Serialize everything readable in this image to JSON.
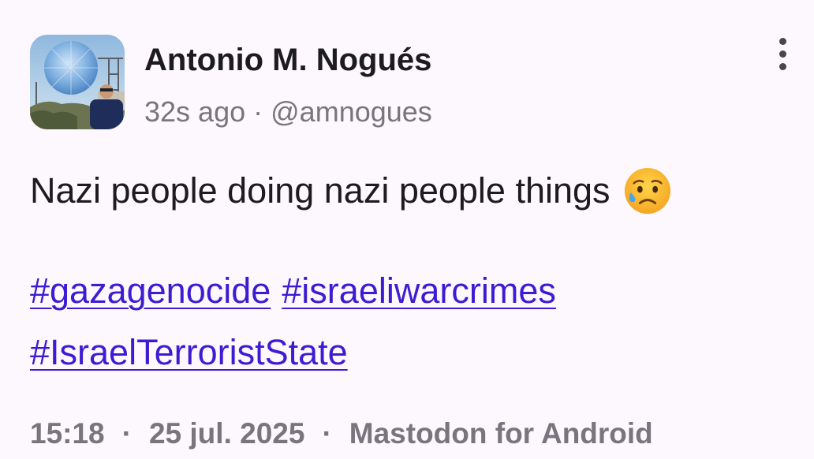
{
  "post": {
    "author": {
      "display_name": "Antonio M. Nogués",
      "time_ago": "32s ago",
      "handle": "@amnogues",
      "meta_separator": "·"
    },
    "text": "Nazi people doing nazi people things",
    "emoji_icon": "sad-but-relieved-face-icon",
    "hashtags": [
      "#gazagenocide",
      "#israeliwarcrimes",
      "#IsraelTerroristState"
    ],
    "footer": {
      "time": "15:18",
      "date": "25 jul. 2025",
      "app": "Mastodon for Android",
      "separator": "·"
    },
    "menu_icon": "more-vertical-icon"
  },
  "colors": {
    "background": "#fdf8fd",
    "text": "#1c1b1f",
    "muted": "#79747e",
    "link": "#3e1bd3"
  }
}
